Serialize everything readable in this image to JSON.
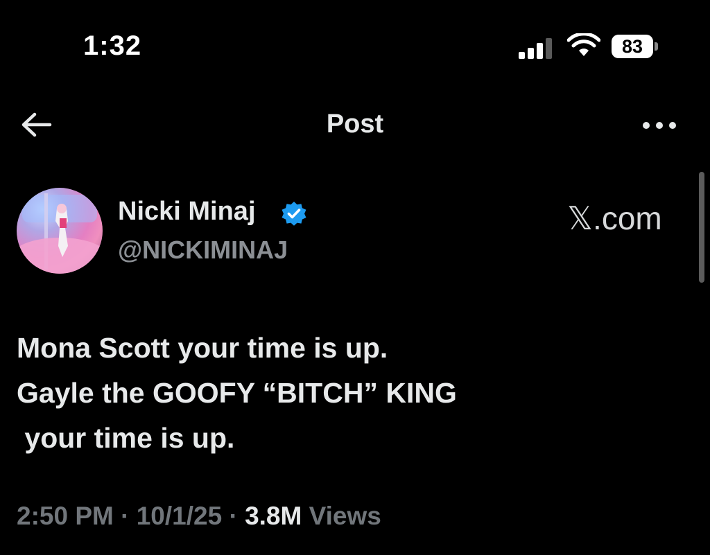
{
  "status_bar": {
    "time": "1:32",
    "battery_level": "83"
  },
  "header": {
    "title": "Post"
  },
  "post": {
    "author_name": "Nicki Minaj",
    "handle": "@NICKIMINAJ",
    "watermark": "𝕏.com",
    "lines": [
      "Mona Scott your time is up.",
      "Gayle the GOOFY “BITCH” KING",
      " your time is up."
    ],
    "time": "2:50 PM",
    "separator": "·",
    "date": "10/1/25",
    "views_count": "3.8M",
    "views_label": "Views"
  },
  "colors": {
    "background": "#000000",
    "text_primary": "#e7e9ea",
    "text_secondary": "#71767b",
    "verified_badge": "#1d9bf0"
  },
  "icons": [
    "back-arrow-icon",
    "more-options-icon",
    "verified-badge-icon",
    "cellular-signal-icon",
    "wifi-icon",
    "battery-icon"
  ]
}
